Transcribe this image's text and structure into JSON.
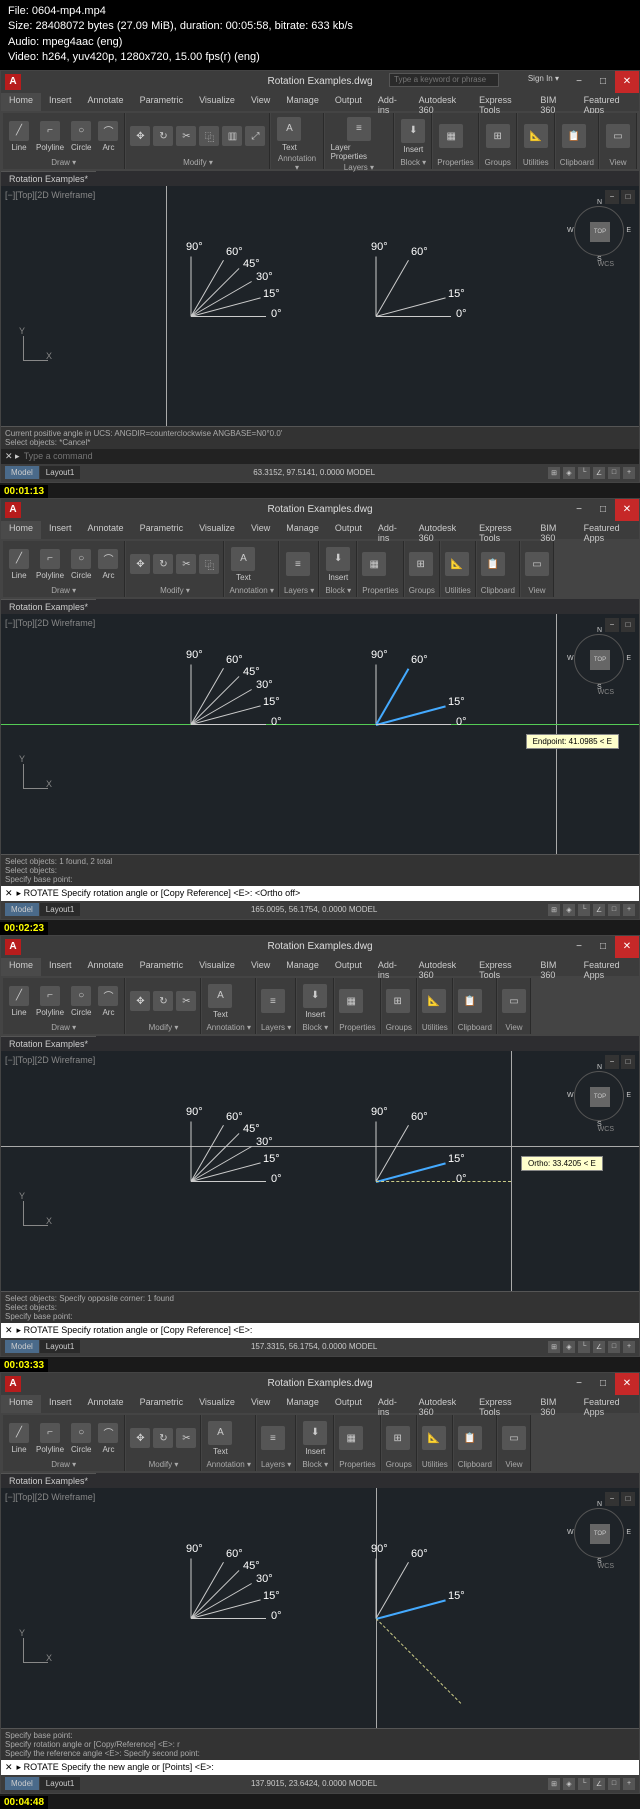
{
  "header": {
    "file": "File: 0604-mp4.mp4",
    "size": "Size: 28408072 bytes (27.09 MiB), duration: 00:05:58, bitrate: 633 kb/s",
    "audio": "Audio: mpeg4aac (eng)",
    "video": "Video: h264, yuv420p, 1280x720, 15.00 fps(r) (eng)"
  },
  "app": {
    "title": "Rotation Examples.dwg",
    "logo": "A",
    "search_placeholder": "Type a keyword or phrase",
    "signin": "Sign In",
    "filetab": "Rotation Examples*",
    "viewport_label": "[−][Top][2D Wireframe]"
  },
  "tabs": [
    "Home",
    "Insert",
    "Annotate",
    "Parametric",
    "Visualize",
    "View",
    "Manage",
    "Output",
    "Add-ins",
    "Autodesk 360",
    "Express Tools",
    "BIM 360",
    "Featured Apps"
  ],
  "panels": {
    "draw": {
      "label": "Draw ▾",
      "items": [
        "Line",
        "Polyline",
        "Circle",
        "Arc"
      ]
    },
    "modify": {
      "label": "Modify ▾"
    },
    "annotation": {
      "label": "Annotation ▾",
      "text": "Text"
    },
    "layers": {
      "label": "Layers ▾",
      "lp": "Layer Properties"
    },
    "block": {
      "label": "Block ▾",
      "insert": "Insert"
    },
    "properties": {
      "label": "Properties"
    },
    "groups": {
      "label": "Groups"
    },
    "utilities": {
      "label": "Utilities"
    },
    "clipboard": {
      "label": "Clipboard"
    },
    "view": {
      "label": "View"
    }
  },
  "compass": {
    "n": "N",
    "s": "S",
    "e": "E",
    "w": "W",
    "top": "TOP",
    "wcs": "WCS"
  },
  "ucs": {
    "x": "X",
    "y": "Y"
  },
  "angles_left": [
    {
      "deg": "90°",
      "rot": -90,
      "len": 60
    },
    {
      "deg": "60°",
      "rot": -60,
      "len": 65
    },
    {
      "deg": "45°",
      "rot": -45,
      "len": 68
    },
    {
      "deg": "30°",
      "rot": -30,
      "len": 70
    },
    {
      "deg": "15°",
      "rot": -15,
      "len": 72
    },
    {
      "deg": "0°",
      "rot": 0,
      "len": 75
    }
  ],
  "angles_right_f1": [
    {
      "deg": "90°",
      "rot": -90
    },
    {
      "deg": "60°",
      "rot": -60
    },
    {
      "deg": "15°",
      "rot": -15
    },
    {
      "deg": "0°",
      "rot": 0
    }
  ],
  "frames": [
    {
      "ts": "00:01:13",
      "cmd1": "Current positive angle in UCS: ANGDIR=counterclockwise ANGBASE=N0°0.0'",
      "cmd2": "Select objects: *Cancel*",
      "cmdprompt": "Type a command",
      "coords": "63.3152, 97.5141, 0.0000",
      "model": "MODEL"
    },
    {
      "ts": "00:02:23",
      "cmd1": "Select objects: 1 found, 2 total",
      "cmd2": "Select objects:",
      "cmd3": "Specify base point:",
      "cmdprompt": "▸ ROTATE Specify rotation angle or [Copy Reference] <E>: <Ortho off>",
      "coords": "165.0095, 56.1754, 0.0000",
      "tooltip": "Endpoint: 41.0985 < E",
      "model": "MODEL"
    },
    {
      "ts": "00:03:33",
      "cmd1": "Select objects: Specify opposite corner: 1 found",
      "cmd2": "Select objects:",
      "cmd3": "Specify base point:",
      "cmdprompt": "▸ ROTATE Specify rotation angle or [Copy Reference] <E>:",
      "coords": "157.3315, 56.1754, 0.0000",
      "tooltip": "Ortho: 33.4205 < E",
      "model": "MODEL"
    },
    {
      "ts": "00:04:48",
      "cmd1": "Specify base point:",
      "cmd2": "Specify rotation angle or [Copy/Reference] <E>: r",
      "cmd3": "Specify the reference angle <E>: Specify second point:",
      "cmdprompt": "▸ ROTATE Specify the new angle or [Points] <E>:",
      "coords": "137.9015, 23.6424, 0.0000",
      "model": "MODEL"
    }
  ],
  "status_tabs": [
    "Model",
    "Layout1"
  ]
}
